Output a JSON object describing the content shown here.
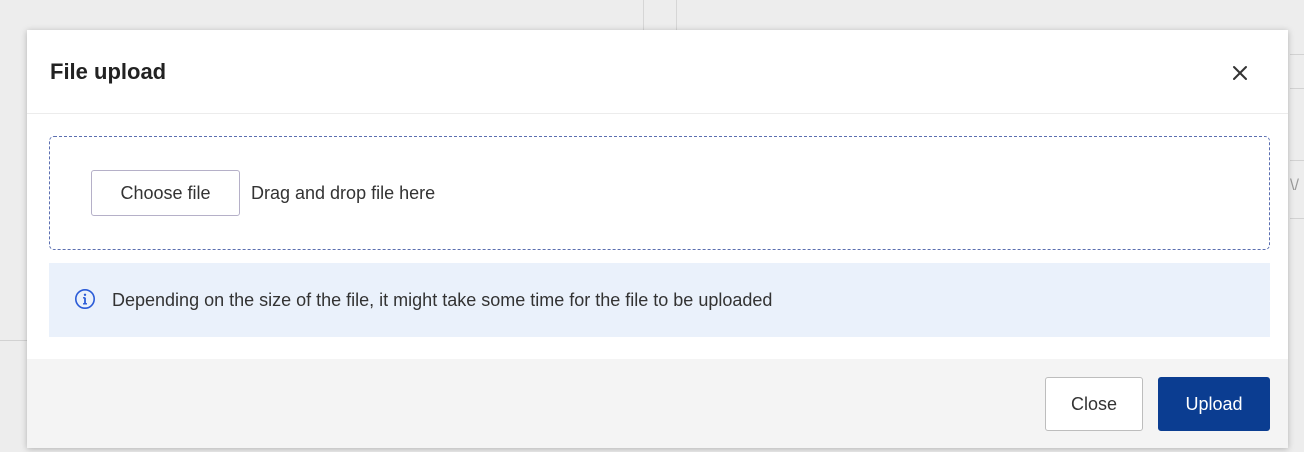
{
  "background": {
    "fragment_text": "\\/"
  },
  "modal": {
    "title": "File upload",
    "close_icon": "close-icon",
    "dropzone": {
      "choose_button_label": "Choose file",
      "drop_hint": "Drag and drop file here"
    },
    "info": {
      "icon": "info-icon",
      "message": "Depending on the size of the file, it might take some time for the file to be uploaded"
    },
    "footer": {
      "close_label": "Close",
      "upload_label": "Upload"
    }
  },
  "colors": {
    "primary": "#0b3d91",
    "info_background": "#eaf1fb",
    "info_icon": "#2a5bd7",
    "dropzone_border": "#5b6fb0",
    "footer_background": "#f4f4f4"
  }
}
